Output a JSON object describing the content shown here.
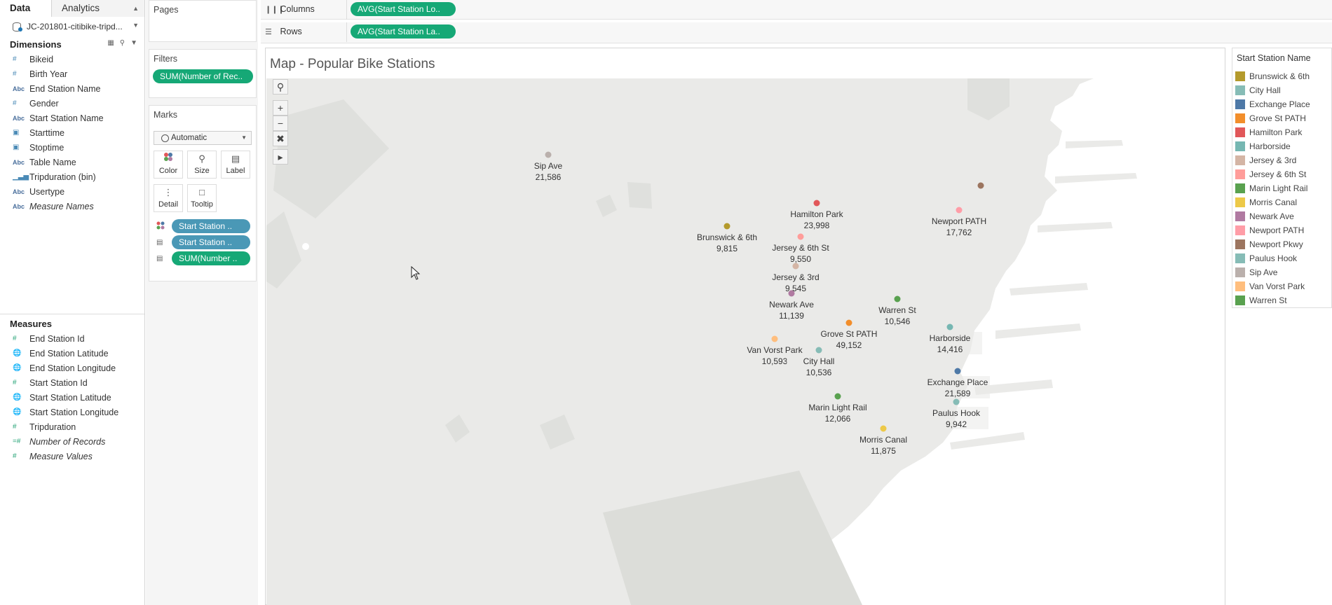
{
  "data_pane": {
    "tab_data": "Data",
    "tab_analytics": "Analytics",
    "datasource": "JC-201801-citibike-tripd...",
    "dimensions_header": "Dimensions",
    "dimensions": [
      {
        "icon": "#",
        "label": "Bikeid",
        "italic": false
      },
      {
        "icon": "#",
        "label": "Birth Year",
        "italic": false
      },
      {
        "icon": "Abc",
        "label": "End Station Name",
        "italic": false
      },
      {
        "icon": "#",
        "label": "Gender",
        "italic": false
      },
      {
        "icon": "Abc",
        "label": "Start Station Name",
        "italic": false
      },
      {
        "icon": "date",
        "label": "Starttime",
        "italic": false
      },
      {
        "icon": "date",
        "label": "Stoptime",
        "italic": false
      },
      {
        "icon": "Abc",
        "label": "Table Name",
        "italic": false
      },
      {
        "icon": "bin",
        "label": "Tripduration (bin)",
        "italic": false
      },
      {
        "icon": "Abc",
        "label": "Usertype",
        "italic": false
      },
      {
        "icon": "Abc",
        "label": "Measure Names",
        "italic": true
      }
    ],
    "measures_header": "Measures",
    "measures": [
      {
        "icon": "#",
        "label": "End Station Id",
        "italic": false
      },
      {
        "icon": "geo",
        "label": "End Station Latitude",
        "italic": false
      },
      {
        "icon": "geo",
        "label": "End Station Longitude",
        "italic": false
      },
      {
        "icon": "#",
        "label": "Start Station Id",
        "italic": false
      },
      {
        "icon": "geo",
        "label": "Start Station Latitude",
        "italic": false
      },
      {
        "icon": "geo",
        "label": "Start Station Longitude",
        "italic": false
      },
      {
        "icon": "#",
        "label": "Tripduration",
        "italic": false
      },
      {
        "icon": "=#",
        "label": "Number of Records",
        "italic": true
      },
      {
        "icon": "#",
        "label": "Measure Values",
        "italic": true
      }
    ]
  },
  "pages": {
    "title": "Pages"
  },
  "filters": {
    "title": "Filters",
    "pill": "SUM(Number of Rec.."
  },
  "marks": {
    "title": "Marks",
    "type": "Automatic",
    "buttons": [
      "Color",
      "Size",
      "Label",
      "Detail",
      "Tooltip"
    ],
    "rows": [
      "Start Station ..",
      "Start Station ..",
      "SUM(Number .."
    ]
  },
  "shelves": {
    "columns_label": "Columns",
    "columns_pill": "AVG(Start Station Lo..",
    "rows_label": "Rows",
    "rows_pill": "AVG(Start Station La.."
  },
  "sheet": {
    "title": "Map - Popular Bike Stations"
  },
  "legend": {
    "title": "Start Station Name",
    "items": [
      {
        "label": "Brunswick & 6th",
        "color": "#b49a2c"
      },
      {
        "label": "City Hall",
        "color": "#86bcb6"
      },
      {
        "label": "Exchange Place",
        "color": "#4e79a7"
      },
      {
        "label": "Grove St PATH",
        "color": "#f28e2b"
      },
      {
        "label": "Hamilton Park",
        "color": "#e15759"
      },
      {
        "label": "Harborside",
        "color": "#76b7b2"
      },
      {
        "label": "Jersey & 3rd",
        "color": "#d4b5a5"
      },
      {
        "label": "Jersey & 6th St",
        "color": "#ff9d9a"
      },
      {
        "label": "Marin Light Rail",
        "color": "#59a14f"
      },
      {
        "label": "Morris Canal",
        "color": "#edc948"
      },
      {
        "label": "Newark Ave",
        "color": "#b07aa1"
      },
      {
        "label": "Newport PATH",
        "color": "#ff9da7"
      },
      {
        "label": "Newport Pkwy",
        "color": "#9c755f"
      },
      {
        "label": "Paulus Hook",
        "color": "#86bcb6"
      },
      {
        "label": "Sip Ave",
        "color": "#bab0ac"
      },
      {
        "label": "Van Vorst Park",
        "color": "#ffbe7d"
      },
      {
        "label": "Warren St",
        "color": "#59a14f"
      }
    ]
  },
  "map_points": [
    {
      "name": "Sip Ave",
      "value": "21,586",
      "color": "#bab0ac"
    },
    {
      "name": "Hamilton Park",
      "value": "23,998",
      "color": "#e15759"
    },
    {
      "name": "Newport PATH",
      "value": "17,762",
      "color": "#ff9da7"
    },
    {
      "name": "",
      "value": "",
      "color": "#9c755f"
    },
    {
      "name": "Brunswick & 6th",
      "value": "9,815",
      "color": "#b49a2c"
    },
    {
      "name": "Jersey & 6th St",
      "value": "9,550",
      "color": "#ff9d9a"
    },
    {
      "name": "Jersey & 3rd",
      "value": "9,545",
      "color": "#d4b5a5"
    },
    {
      "name": "Newark Ave",
      "value": "11,139",
      "color": "#b07aa1"
    },
    {
      "name": "Warren St",
      "value": "10,546",
      "color": "#59a14f"
    },
    {
      "name": "Grove St PATH",
      "value": "49,152",
      "color": "#f28e2b"
    },
    {
      "name": "Harborside",
      "value": "14,416",
      "color": "#76b7b2"
    },
    {
      "name": "Van Vorst Park",
      "value": "10,593",
      "color": "#ffbe7d"
    },
    {
      "name": "City Hall",
      "value": "10,536",
      "color": "#86bcb6"
    },
    {
      "name": "Exchange Place",
      "value": "21,589",
      "color": "#4e79a7"
    },
    {
      "name": "Marin Light Rail",
      "value": "12,066",
      "color": "#59a14f"
    },
    {
      "name": "Paulus Hook",
      "value": "9,942",
      "color": "#86bcb6"
    },
    {
      "name": "Morris Canal",
      "value": "11,875",
      "color": "#edc948"
    }
  ]
}
